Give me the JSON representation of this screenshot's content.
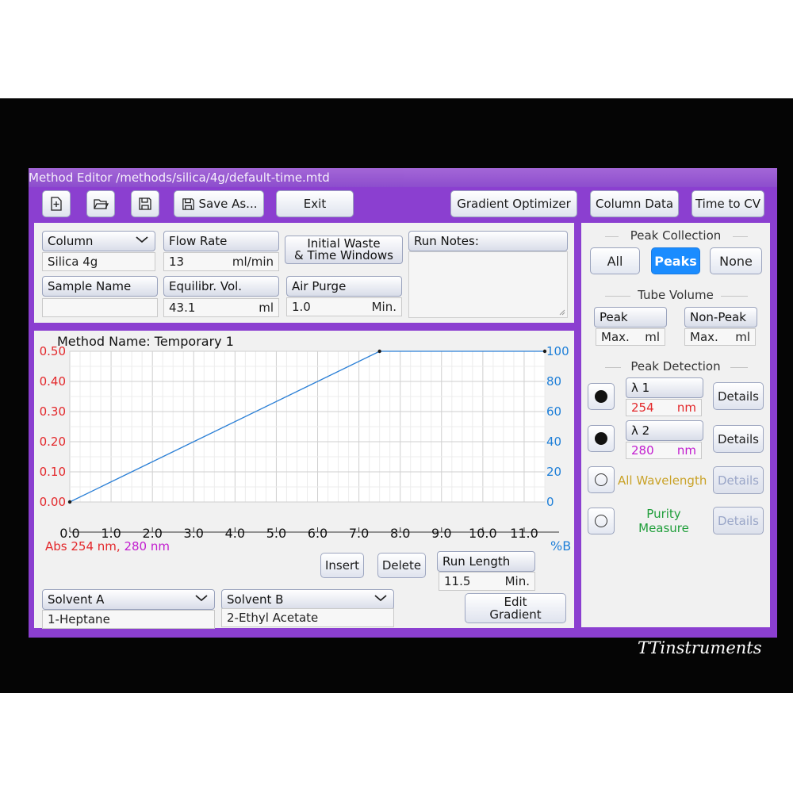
{
  "window": {
    "title": "Method Editor /methods/silica/4g/default-time.mtd"
  },
  "toolbar": {
    "save_as_label": "Save As...",
    "exit_label": "Exit",
    "gradient_optimizer_label": "Gradient Optimizer",
    "column_data_label": "Column Data",
    "time_to_cv_label": "Time to CV"
  },
  "params": {
    "column_label": "Column",
    "column_value": "Silica 4g",
    "flow_rate_label": "Flow Rate",
    "flow_rate_value": "13",
    "flow_rate_unit": "ml/min",
    "initial_waste_line1": "Initial Waste",
    "initial_waste_line2": "& Time Windows",
    "run_notes_label": "Run Notes:",
    "run_notes_value": "",
    "sample_name_label": "Sample Name",
    "sample_name_value": "",
    "equilibr_label": "Equilibr. Vol.",
    "equilibr_value": "43.1",
    "equilibr_unit": "ml",
    "air_purge_label": "Air Purge",
    "air_purge_value": "1.0",
    "air_purge_unit": "Min."
  },
  "chart_data": {
    "type": "line",
    "title": "Method Name: Temporary 1",
    "x": [
      0.0,
      7.5,
      11.5
    ],
    "series": [
      {
        "values": [
          0,
          100,
          100
        ]
      }
    ],
    "xlim": [
      0,
      11.5
    ],
    "xticks": [
      "0.0",
      "1.0",
      "2.0",
      "3.0",
      "4.0",
      "5.0",
      "6.0",
      "7.0",
      "8.0",
      "9.0",
      "10.0",
      "11.0"
    ],
    "left_axis_ticks": [
      "0.50",
      "0.40",
      "0.30",
      "0.20",
      "0.10",
      "0.00"
    ],
    "left_ylim": [
      0,
      0.5
    ],
    "right_axis_ticks": [
      "100",
      "80",
      "60",
      "40",
      "20",
      "0"
    ],
    "right_ylim": [
      0,
      100
    ],
    "left_label_part1": "Abs 254 nm,",
    "left_label_part2": "280 nm",
    "right_label": "%B",
    "grid": true,
    "colors": {
      "line": "#2a7fd6",
      "left_axis": "#e3282b",
      "right_axis": "#1e7fd8",
      "label2": "#c21ecf"
    }
  },
  "chart_controls": {
    "insert_label": "Insert",
    "delete_label": "Delete",
    "run_length_label": "Run Length",
    "run_length_value": "11.5",
    "run_length_unit": "Min."
  },
  "solvents": {
    "a_label": "Solvent A",
    "a_value": "1-Heptane",
    "b_label": "Solvent B",
    "b_value": "2-Ethyl Acetate",
    "edit_gradient_line1": "Edit",
    "edit_gradient_line2": "Gradient"
  },
  "right_panel": {
    "peak_collection_title": "Peak Collection",
    "collection_options": [
      "All",
      "Peaks",
      "None"
    ],
    "collection_selected": "Peaks",
    "tube_volume_title": "Tube Volume",
    "peak_label": "Peak",
    "peak_value": "Max.",
    "peak_unit": "ml",
    "nonpeak_label": "Non-Peak",
    "nonpeak_value": "Max.",
    "nonpeak_unit": "ml",
    "peak_detection_title": "Peak Detection",
    "lambda1_label": "λ 1",
    "lambda1_value": "254",
    "lambda1_unit": "nm",
    "lambda2_label": "λ 2",
    "lambda2_value": "280",
    "lambda2_unit": "nm",
    "all_wavelength_label": "All Wavelength",
    "purity_line1": "Purity",
    "purity_line2": "Measure",
    "details_label": "Details",
    "colors": {
      "lambda1": "#e3282b",
      "lambda2": "#c21ecf",
      "all_wavelength": "#c9a227",
      "purity": "#1f9e3a",
      "selected": "#1a8cff"
    }
  },
  "branding": {
    "watermark": "TTinstruments"
  }
}
